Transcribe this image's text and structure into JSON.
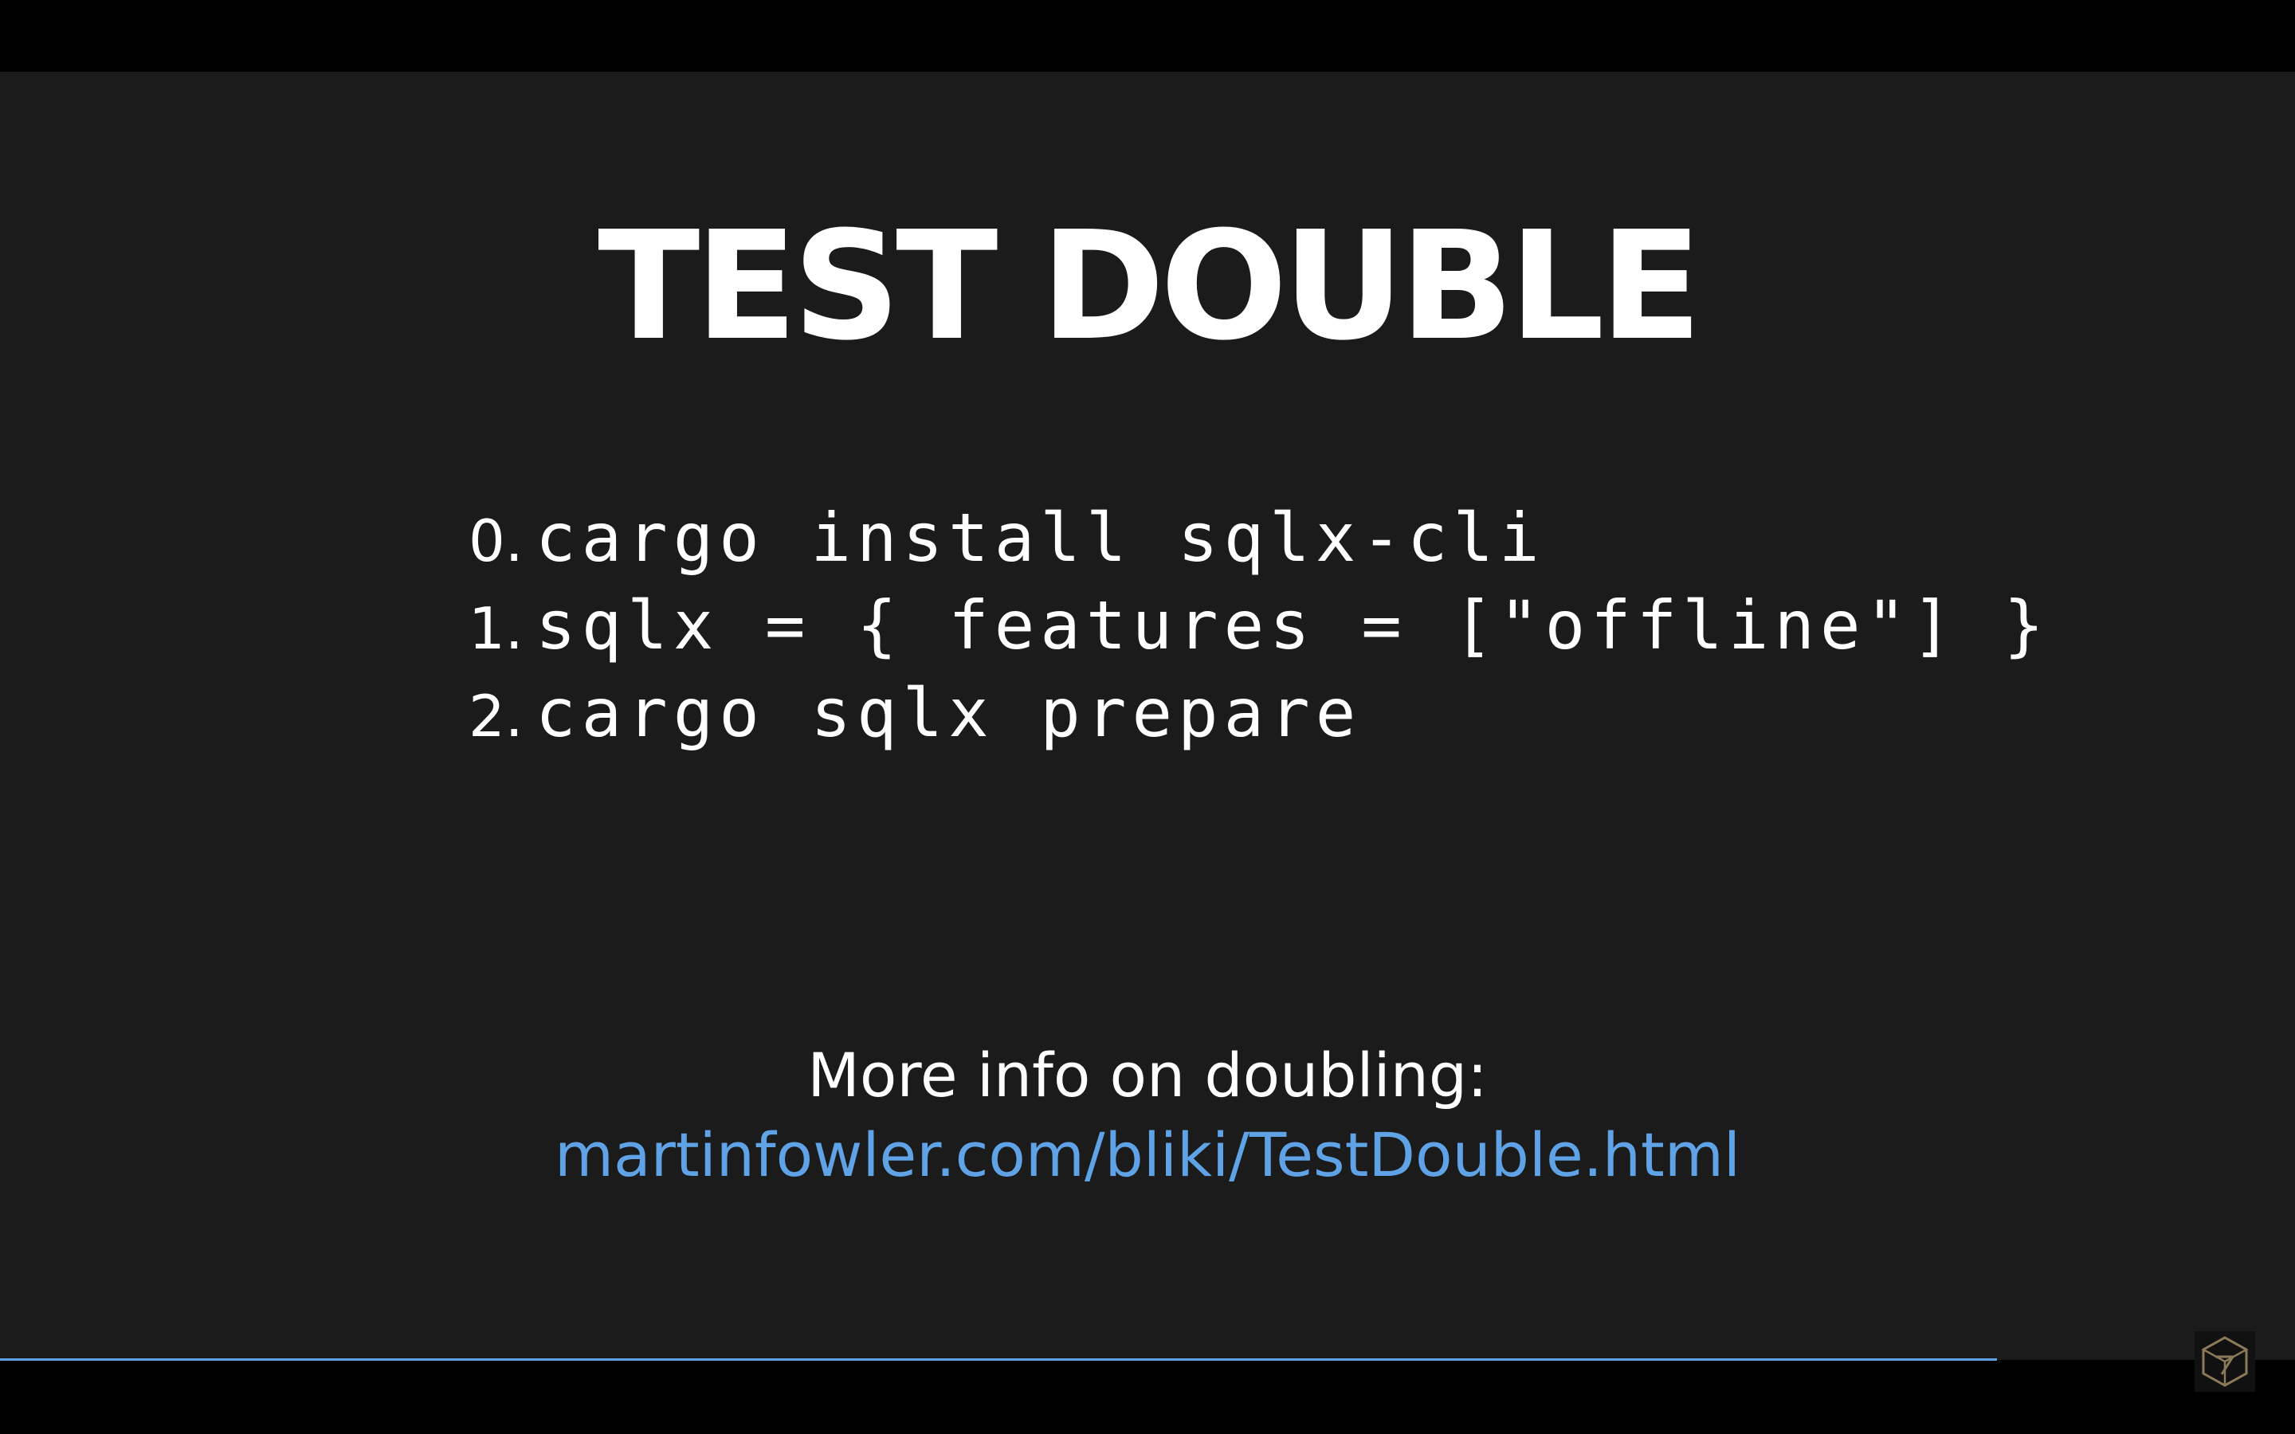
{
  "slide": {
    "title": "TEST DOUBLE",
    "steps": [
      {
        "number": "0.",
        "code": "cargo install sqlx-cli"
      },
      {
        "number": "1.",
        "code": "sqlx = { features = [\"offline\"] }"
      },
      {
        "number": "2.",
        "code": "cargo sqlx prepare"
      }
    ],
    "more_info": "More info on doubling:",
    "link": "martinfowler.com/bliki/TestDouble.html"
  },
  "progress": {
    "fraction": 0.87,
    "color": "#5fa3e6"
  },
  "colors": {
    "background": "#1b1b1b",
    "text": "#ffffff",
    "link": "#5fa3e6",
    "logo_stroke": "#8a7a5a"
  },
  "icons": {
    "logo": "geometric-cube-logo-icon"
  }
}
